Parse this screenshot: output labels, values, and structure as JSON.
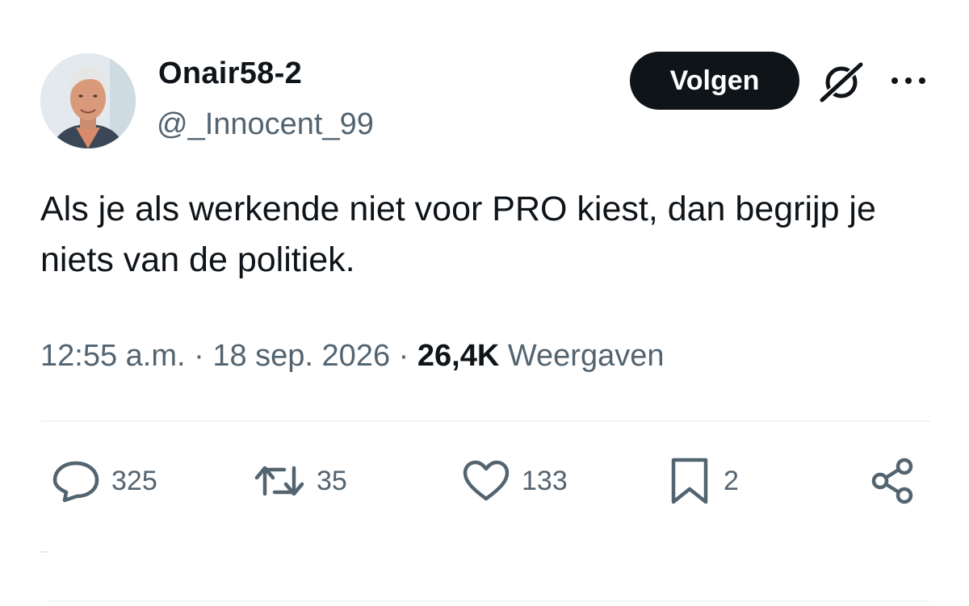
{
  "user": {
    "display_name": "Onair58-2",
    "handle": "@_Innocent_99"
  },
  "header": {
    "follow_label": "Volgen",
    "grok_icon": "grok-slash-icon",
    "more_icon": "more-dots-icon"
  },
  "tweet": {
    "text": "Als je als werkende niet voor PRO kiest, dan begrijp je niets van de politiek."
  },
  "meta": {
    "time": "12:55 a.m.",
    "separator1": " · ",
    "date": "18 sep. 2026",
    "separator2": " · ",
    "views_count": "26,4K",
    "views_label": "Weergaven"
  },
  "actions": {
    "replies": "325",
    "reposts": "35",
    "likes": "133",
    "bookmarks": "2"
  },
  "colors": {
    "text": "#0f1419",
    "secondary": "#536471",
    "follow_bg": "#0f1419",
    "divider": "#eff3f4"
  }
}
